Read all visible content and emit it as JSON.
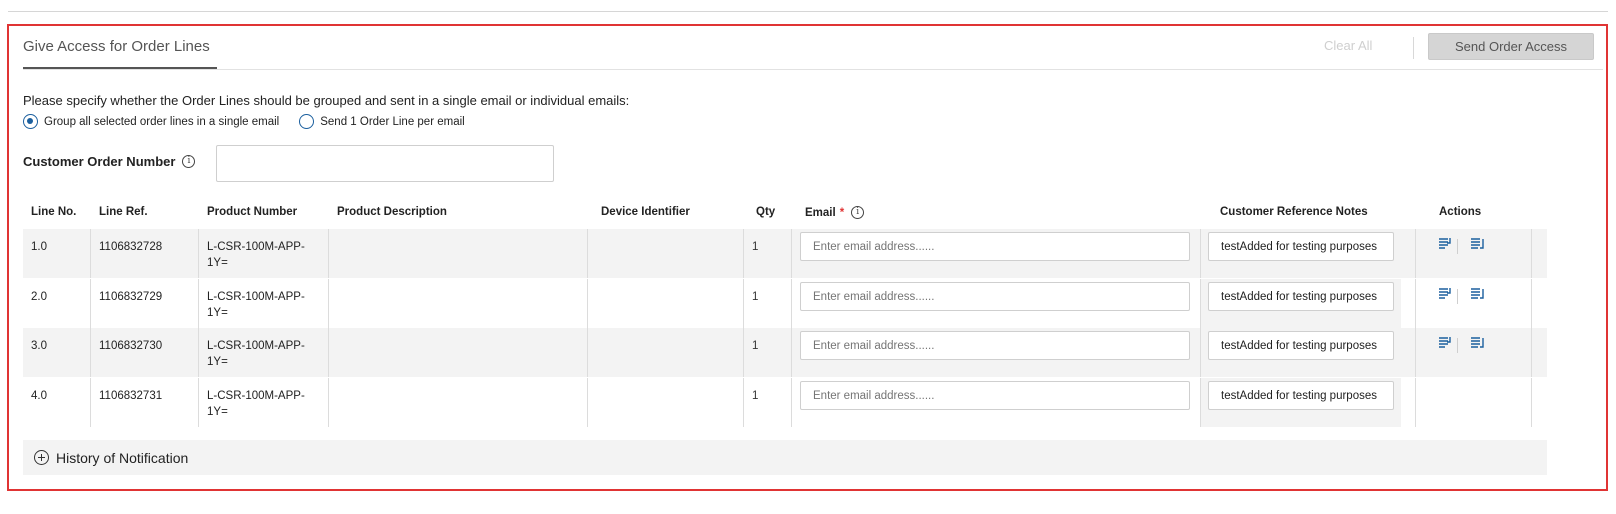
{
  "section": {
    "title": "Give Access for Order Lines",
    "clear_all": "Clear All",
    "send_button": "Send Order Access"
  },
  "grouping": {
    "instruction": "Please specify whether the Order Lines should be grouped and sent in a single email or individual emails:",
    "options": [
      {
        "label": "Group all selected order lines in a single email",
        "selected": true
      },
      {
        "label": "Send 1 Order Line per email",
        "selected": false
      }
    ]
  },
  "customer_order": {
    "label": "Customer Order Number",
    "value": ""
  },
  "table": {
    "headers": {
      "line_no": "Line No.",
      "line_ref": "Line Ref.",
      "product_number": "Product Number",
      "product_description": "Product Description",
      "device_identifier": "Device Identifier",
      "qty": "Qty",
      "email": "Email",
      "email_required": "*",
      "notes": "Customer Reference Notes",
      "actions": "Actions"
    },
    "email_placeholder": "Enter email address......",
    "rows": [
      {
        "line_no": "1.0",
        "line_ref": "1106832728",
        "product_line1": "L-CSR-100M-APP-",
        "product_line2": "1Y=",
        "description": "",
        "device": "",
        "qty": "1",
        "email": "",
        "notes": "testAdded for testing purposes",
        "has_actions": true
      },
      {
        "line_no": "2.0",
        "line_ref": "1106832729",
        "product_line1": "L-CSR-100M-APP-",
        "product_line2": "1Y=",
        "description": "",
        "device": "",
        "qty": "1",
        "email": "",
        "notes": "testAdded for testing purposes",
        "has_actions": true
      },
      {
        "line_no": "3.0",
        "line_ref": "1106832730",
        "product_line1": "L-CSR-100M-APP-",
        "product_line2": "1Y=",
        "description": "",
        "device": "",
        "qty": "1",
        "email": "",
        "notes": "testAdded for testing purposes",
        "has_actions": true
      },
      {
        "line_no": "4.0",
        "line_ref": "1106832731",
        "product_line1": "L-CSR-100M-APP-",
        "product_line2": "1Y=",
        "description": "",
        "device": "",
        "qty": "1",
        "email": "",
        "notes": "testAdded for testing purposes",
        "has_actions": false
      }
    ],
    "action_icons": [
      "copy-email-down-icon",
      "apply-notes-icon"
    ]
  },
  "history": {
    "label": "History of Notification"
  },
  "colors": {
    "panel_border": "#e03434",
    "accent": "#1b5f9e",
    "row_shade": "#f3f3f3"
  }
}
